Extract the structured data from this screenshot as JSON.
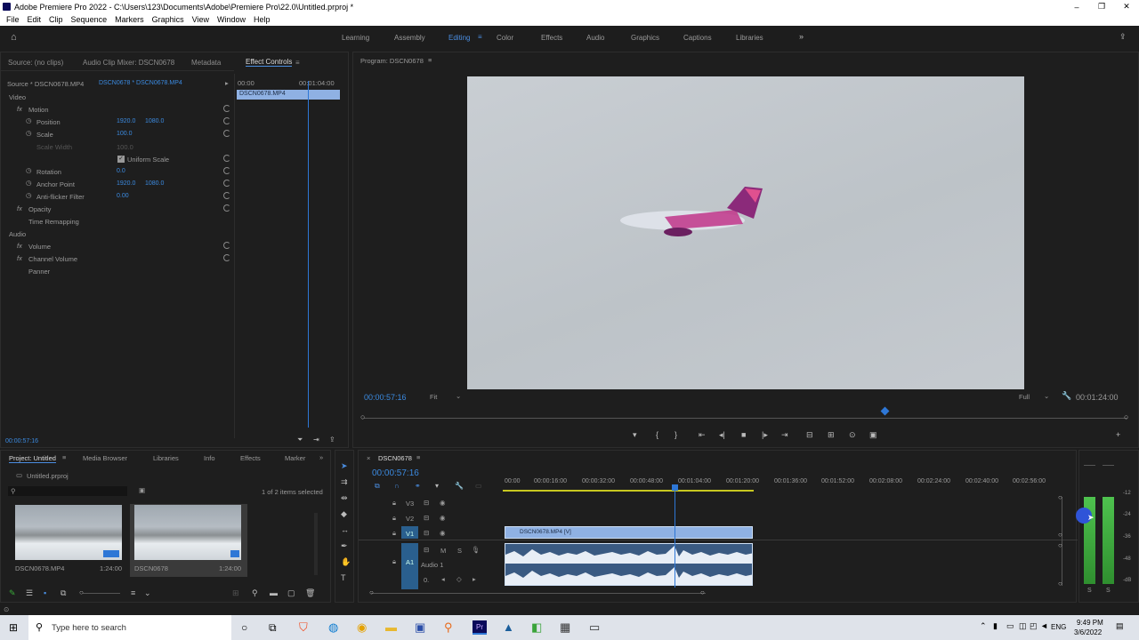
{
  "window": {
    "title": "Adobe Premiere Pro 2022 - C:\\Users\\123\\Documents\\Adobe\\Premiere Pro\\22.0\\Untitled.prproj *"
  },
  "menu": [
    "File",
    "Edit",
    "Clip",
    "Sequence",
    "Markers",
    "Graphics",
    "View",
    "Window",
    "Help"
  ],
  "workspaces": [
    "Learning",
    "Assembly",
    "Editing",
    "Color",
    "Effects",
    "Audio",
    "Graphics",
    "Captions",
    "Libraries"
  ],
  "active_workspace": "Editing",
  "source_tabs": [
    "Source: (no clips)",
    "Audio Clip Mixer: DSCN0678",
    "Metadata",
    "Effect Controls"
  ],
  "effect_controls": {
    "source_label": "Source * DSCN0678.MP4",
    "sequence_label": "DSCN0678 * DSCN0678.MP4",
    "time_start": "00:00",
    "time_mark": "00:01:04:00",
    "clip_name": "DSCN0678.MP4",
    "section_video": "Video",
    "section_audio": "Audio",
    "motion": "Motion",
    "position": {
      "label": "Position",
      "x": "1920.0",
      "y": "1080.0"
    },
    "scale": {
      "label": "Scale",
      "value": "100.0"
    },
    "scale_width": {
      "label": "Scale Width",
      "value": "100.0"
    },
    "uniform_scale": "Uniform Scale",
    "rotation": {
      "label": "Rotation",
      "value": "0.0"
    },
    "anchor": {
      "label": "Anchor Point",
      "x": "1920.0",
      "y": "1080.0"
    },
    "antiflicker": {
      "label": "Anti-flicker Filter",
      "value": "0.00"
    },
    "opacity": "Opacity",
    "time_remap": "Time Remapping",
    "volume": "Volume",
    "channel_volume": "Channel Volume",
    "panner": "Panner",
    "current_time": "00:00:57:16",
    "fx": "fx"
  },
  "program": {
    "title": "Program: DSCN0678",
    "timecode": "00:00:57:16",
    "zoom": "Fit",
    "quality": "Full",
    "duration": "00:01:24:00"
  },
  "project": {
    "tabs": [
      "Project: Untitled",
      "Media Browser",
      "Libraries",
      "Info",
      "Effects",
      "Marker"
    ],
    "file": "Untitled.prproj",
    "selection": "1 of 2 items selected",
    "items": [
      {
        "name": "DSCN0678.MP4",
        "duration": "1:24:00"
      },
      {
        "name": "DSCN0678",
        "duration": "1:24:00"
      }
    ]
  },
  "timeline": {
    "title": "DSCN0678",
    "timecode": "00:00:57:16",
    "ruler": [
      "00:00",
      "00:00:16:00",
      "00:00:32:00",
      "00:00:48:00",
      "00:01:04:00",
      "00:01:20:00",
      "00:01:36:00",
      "00:01:52:00",
      "00:02:08:00",
      "00:02:24:00",
      "00:02:40:00",
      "00:02:56:00"
    ],
    "tracks": [
      "V3",
      "V2",
      "V1",
      "A1"
    ],
    "audio_name": "Audio 1",
    "video_clip": "DSCN0678.MP4 [V]",
    "m": "M",
    "s": "S",
    "zero": "0."
  },
  "meters": {
    "labels": [
      "-12",
      "-24",
      "-36",
      "-48",
      "-dB"
    ],
    "s1": "S",
    "s2": "S"
  },
  "taskbar": {
    "search": "Type here to search",
    "lang": "ENG",
    "time": "9:49 PM",
    "date": "3/6/2022"
  },
  "colors": {
    "accent": "#2e77d6",
    "clip": "#8fb1e3",
    "audio": "#3a5a82"
  }
}
